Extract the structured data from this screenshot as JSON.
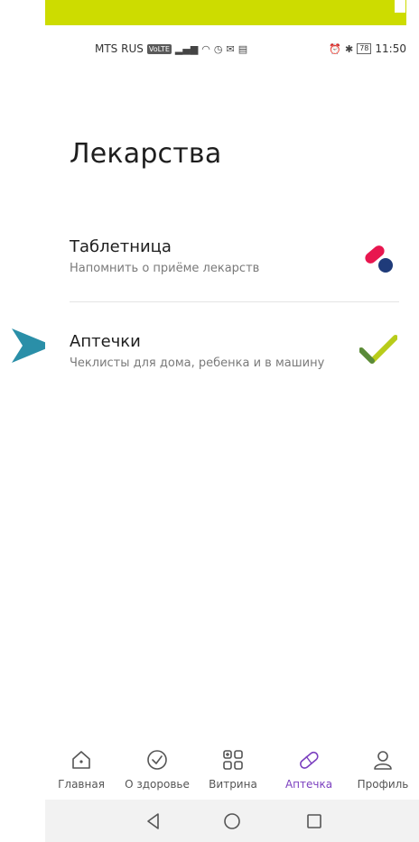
{
  "status_bar": {
    "carrier": "MTS RUS",
    "volte": "VoLTE",
    "battery": "78",
    "time": "11:50"
  },
  "page_title": "Лекарства",
  "menu": [
    {
      "title": "Таблетница",
      "subtitle": "Напомнить о приёме лекарств",
      "icon": "pill-icon"
    },
    {
      "title": "Аптечки",
      "subtitle": "Чеклисты для дома, ребенка и в машину",
      "icon": "check-icon"
    }
  ],
  "bottom_nav": [
    {
      "label": "Главная",
      "icon": "home-icon",
      "active": false
    },
    {
      "label": "О здоровье",
      "icon": "check-circle-icon",
      "active": false
    },
    {
      "label": "Витрина",
      "icon": "grid-plus-icon",
      "active": false
    },
    {
      "label": "Аптечка",
      "icon": "pill-icon",
      "active": true
    },
    {
      "label": "Профиль",
      "icon": "user-icon",
      "active": false
    }
  ],
  "colors": {
    "banner": "#cddc00",
    "arrow": "#2a8fa8",
    "pill_red": "#e8164f",
    "pill_blue": "#1f3b7a",
    "check_green": "#b8cc1a",
    "active_nav": "#7b3fbf"
  }
}
